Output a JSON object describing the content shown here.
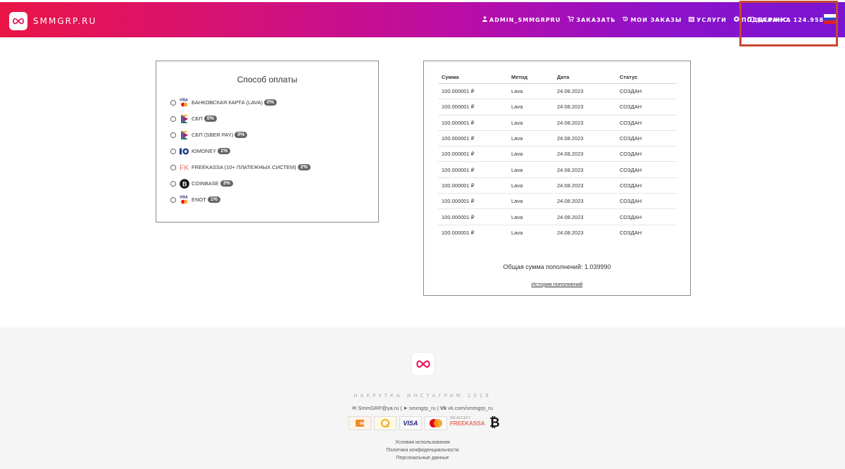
{
  "header": {
    "logo_text": "SMMGRP.RU",
    "nav": [
      {
        "icon": "user-icon",
        "label": "ADMIN_SMMGRPRU"
      },
      {
        "icon": "cart-icon",
        "label": "ЗАКАЗАТЬ"
      },
      {
        "icon": "history-icon",
        "label": "МОИ ЗАКАЗЫ"
      },
      {
        "icon": "list-icon",
        "label": "УСЛУГИ"
      },
      {
        "icon": "help-icon",
        "label": "ПОДДЕРЖКА"
      }
    ],
    "balance_label": "БАЛАНС: 124.958 ₽",
    "flag": "russia-flag-icon"
  },
  "payment": {
    "title": "Способ оплаты",
    "methods": [
      {
        "icon": "visa-mastercard-icon",
        "label": "БАНКОВСКАЯ КАРТА (LAVA)",
        "fee": "0%"
      },
      {
        "icon": "sbp-icon",
        "label": "СБП",
        "fee": "0%"
      },
      {
        "icon": "sbp-icon",
        "label": "СБП (SBER PAY)",
        "fee": "0%"
      },
      {
        "icon": "yoomoney-icon",
        "label": "ЮMONEY",
        "fee": "1%"
      },
      {
        "icon": "freekassa-icon",
        "label": "FREEKASSA (10+ ПЛАТЕЖНЫХ СИСТЕМ)",
        "fee": "2%"
      },
      {
        "icon": "bitcoin-icon",
        "label": "COINBASE",
        "fee": "3%"
      },
      {
        "icon": "visa-mastercard-icon",
        "label": "ENOT",
        "fee": "1%"
      }
    ]
  },
  "history": {
    "columns": [
      "Сумма",
      "Метод",
      "Дата",
      "Статус"
    ],
    "rows": [
      [
        "100.000001 ₽",
        "Lava",
        "24.08.2023",
        "СОЗДАН"
      ],
      [
        "100.000001 ₽",
        "Lava",
        "24.08.2023",
        "СОЗДАН"
      ],
      [
        "100.000001 ₽",
        "Lava",
        "24.08.2023",
        "СОЗДАН"
      ],
      [
        "100.000001 ₽",
        "Lava",
        "24.08.2023",
        "СОЗДАН"
      ],
      [
        "100.000001 ₽",
        "Lava",
        "24.08.2023",
        "СОЗДАН"
      ],
      [
        "100.000001 ₽",
        "Lava",
        "24.08.2023",
        "СОЗДАН"
      ],
      [
        "100.000001 ₽",
        "Lava",
        "24.08.2023",
        "СОЗДАН"
      ],
      [
        "100.000001 ₽",
        "Lava",
        "24.08.2023",
        "СОЗДАН"
      ],
      [
        "100.000001 ₽",
        "Lava",
        "24.08.2023",
        "СОЗДАН"
      ],
      [
        "100.000001 ₽",
        "Lava",
        "24.08.2023",
        "СОЗДАН"
      ]
    ],
    "total": "Общая сумма пополнений: 1.039990",
    "link": "История пополнений"
  },
  "footer": {
    "tagline": "НАКРУТКА ИНСТАГРАМ 2018",
    "email": "SmmGRP@ya.ru",
    "telegram": "smmgrp_ru",
    "vk": "vk.com/smmgrp_ru",
    "links": [
      "Условия использования",
      "Политика конфиденциальности",
      "Персональные данные"
    ],
    "freekassa_small": "WE ACCEPT",
    "freekassa_big": "FREEKASSA",
    "visa": "VISA"
  },
  "colors": {
    "accent_start": "#ea1546",
    "accent_end": "#7a14d2",
    "badge": "#666666",
    "highlight": "#c9472f"
  }
}
